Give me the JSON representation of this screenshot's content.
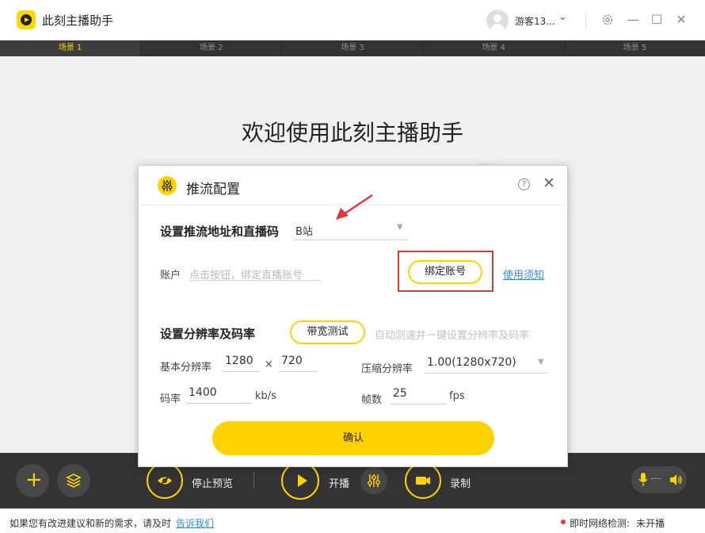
{
  "app": {
    "title": "此刻主播助手"
  },
  "user": {
    "name": "游客13..."
  },
  "scene_tabs": [
    {
      "label": "场景 1",
      "active": true
    },
    {
      "label": "场景 2",
      "active": false
    },
    {
      "label": "场景 3",
      "active": false
    },
    {
      "label": "场景 4",
      "active": false
    },
    {
      "label": "场景 5",
      "active": false
    }
  ],
  "main": {
    "welcome": "欢迎使用此刻主播助手"
  },
  "dialog": {
    "title": "推流配置",
    "section1_title": "设置推流地址和直播码",
    "platform_value": "B站",
    "account_label": "账户",
    "account_placeholder": "点击按钮，绑定直播账号",
    "bind_button": "绑定账号",
    "usage_link": "使用须知",
    "section2_title": "设置分辨率及码率",
    "bandwidth_button": "带宽测试",
    "auto_hint": "自动测速并一键设置分辨率及码率",
    "base_res_label": "基本分辨率",
    "base_res_width": "1280",
    "res_x": "×",
    "base_res_height": "720",
    "compress_label": "压缩分辨率",
    "compress_value": "1.00(1280x720)",
    "bitrate_label": "码率",
    "bitrate_value": "1400",
    "bitrate_unit": "kb/s",
    "fps_label": "帧数",
    "fps_value": "25",
    "fps_unit": "fps",
    "confirm_button": "确认"
  },
  "bottom_bar": {
    "stop_preview": "停止预览",
    "start_live": "开播",
    "record": "录制"
  },
  "status_bar": {
    "feedback_text": "如果您有改进建议和新的需求，请及时",
    "feedback_link": "告诉我们",
    "network_label": "即时网络检测:",
    "network_value": "未开播"
  },
  "colors": {
    "accent": "#ffd200",
    "dark_bar": "#333333",
    "link": "#2f8fd6",
    "highlight": "#e03838"
  }
}
